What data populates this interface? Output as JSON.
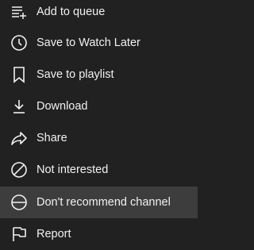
{
  "menu": {
    "items": [
      {
        "label": "Add to queue",
        "icon": "add-to-queue-icon"
      },
      {
        "label": "Save to Watch Later",
        "icon": "clock-icon"
      },
      {
        "label": "Save to playlist",
        "icon": "bookmark-icon"
      },
      {
        "label": "Download",
        "icon": "download-icon"
      },
      {
        "label": "Share",
        "icon": "share-icon"
      },
      {
        "label": "Not interested",
        "icon": "block-icon"
      },
      {
        "label": "Don't recommend channel",
        "icon": "minus-circle-icon"
      },
      {
        "label": "Report",
        "icon": "flag-icon"
      }
    ],
    "hovered_item": "Don't recommend channel"
  },
  "colors": {
    "background": "#212121",
    "hover_background": "#3d3d3d",
    "text": "#f1f1f1",
    "icon": "#f1f1f1"
  }
}
